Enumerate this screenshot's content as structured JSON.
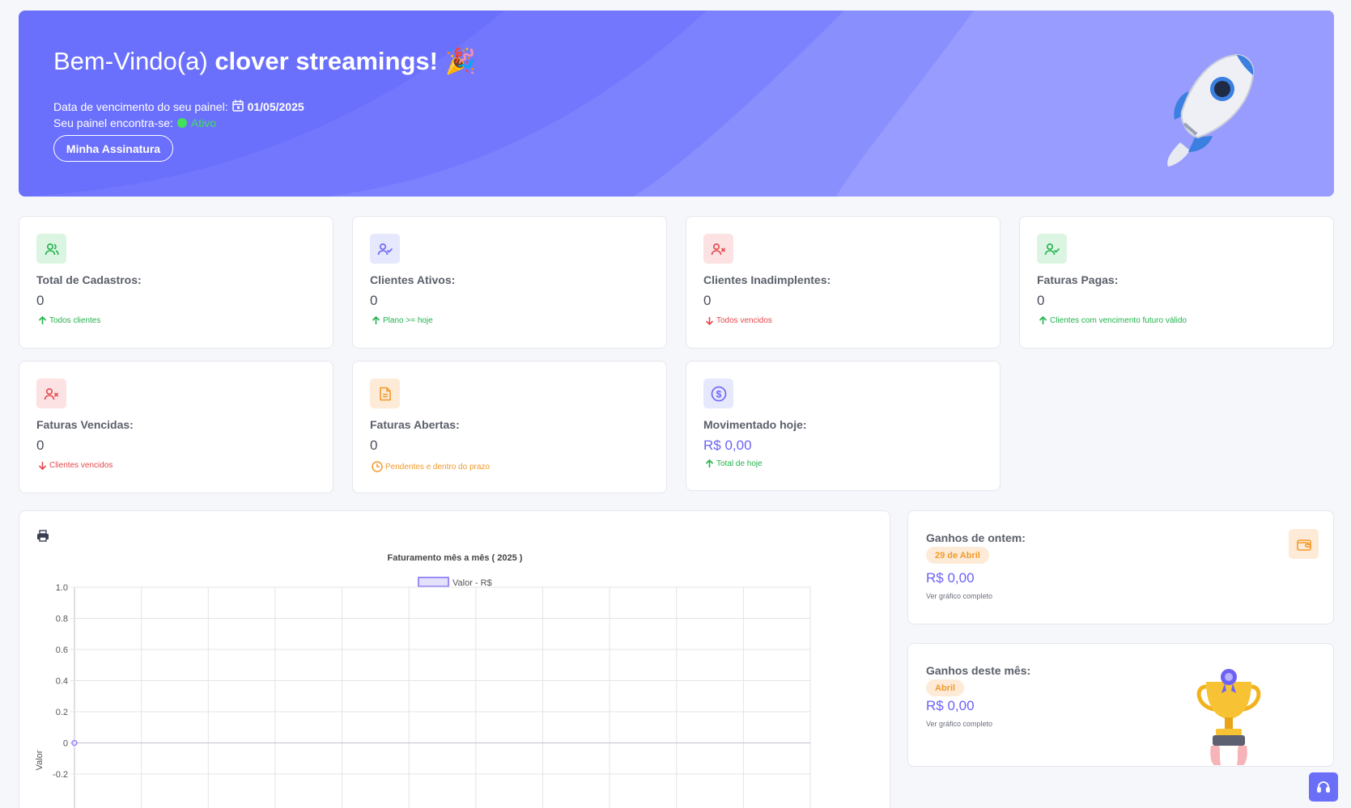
{
  "hero": {
    "welcome_prefix": "Bem-Vindo(a)",
    "username": "clover streamings!",
    "emoji": "🎉",
    "due_label": "Data de vencimento do seu painel:",
    "due_date": "01/05/2025",
    "status_label": "Seu painel encontra-se:",
    "status_value": "Ativo",
    "subscription_button": "Minha Assinatura"
  },
  "stats": [
    {
      "title": "Total de Cadastros:",
      "value": "0",
      "note": "Todos clientes",
      "trend": "up",
      "icon": "users-icon"
    },
    {
      "title": "Clientes Ativos:",
      "value": "0",
      "note": "Plano >= hoje",
      "trend": "up",
      "icon": "user-check-icon"
    },
    {
      "title": "Clientes Inadimplentes:",
      "value": "0",
      "note": "Todos vencidos",
      "trend": "down",
      "icon": "user-x-icon"
    },
    {
      "title": "Faturas Pagas:",
      "value": "0",
      "note": "Clientes com vencimento futuro válido",
      "trend": "up",
      "icon": "user-check-icon"
    },
    {
      "title": "Faturas Vencidas:",
      "value": "0",
      "note": "Clientes vencidos",
      "trend": "down",
      "icon": "user-x-icon"
    },
    {
      "title": "Faturas Abertas:",
      "value": "0",
      "note": "Pendentes e dentro do prazo",
      "trend": "clock",
      "icon": "document-icon"
    },
    {
      "title": "Movimentado hoje:",
      "value": "R$ 0,00",
      "note": "Total de hoje",
      "trend": "up",
      "icon": "dollar-circle-icon"
    }
  ],
  "colors": {
    "banner": "#6b70fc",
    "accent": "#6c63f5",
    "success": "#22b24c",
    "danger": "#e5484d",
    "warning": "#f39a2b"
  },
  "chart_data": {
    "type": "line",
    "title": "Faturamento mês a mês ( 2025 )",
    "series": [
      {
        "name": "Valor - R$",
        "values": [
          0
        ]
      }
    ],
    "ylabel": "Valor",
    "yticks": [
      "1.0",
      "0.8",
      "0.6",
      "0.4",
      "0.2",
      "0",
      "-0.2"
    ],
    "ylim": [
      -0.2,
      1.0
    ],
    "grid": true,
    "legend": "top-center"
  },
  "yesterday": {
    "title": "Ganhos de ontem:",
    "date_pill": "29 de Abril",
    "amount": "R$ 0,00",
    "link": "Ver gráfico completo"
  },
  "month": {
    "title": "Ganhos deste mês:",
    "month_pill": "Abril",
    "amount": "R$ 0,00",
    "link": "Ver gráfico completo"
  }
}
